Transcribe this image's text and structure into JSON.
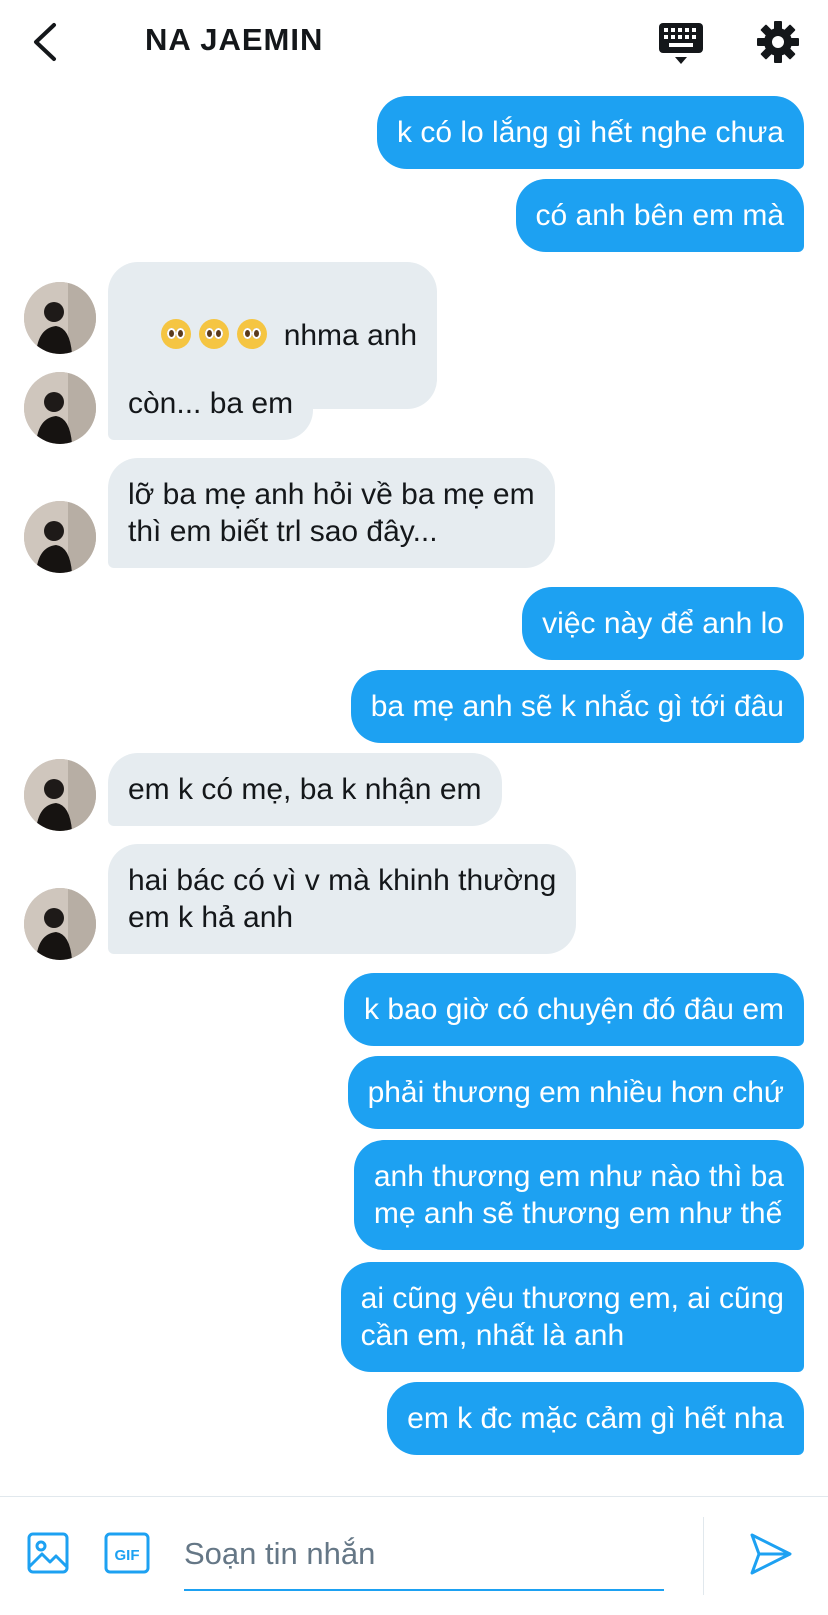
{
  "header": {
    "title": "NA JAEMIN",
    "back_icon": "chevron-left-icon",
    "keyboard_icon": "keyboard-icon",
    "settings_icon": "gear-icon"
  },
  "messages": [
    {
      "side": "sent",
      "text": "k có lo lắng gì hết nghe chưa"
    },
    {
      "side": "sent",
      "text": "có anh bên em mà"
    },
    {
      "side": "received",
      "text": "nhma anh",
      "emoji": [
        "pleading-face",
        "pleading-face",
        "pleading-face"
      ]
    },
    {
      "side": "received",
      "text": "còn... ba em"
    },
    {
      "side": "received",
      "text": "lỡ ba mẹ anh hỏi về ba mẹ em\nthì em biết trl sao đây..."
    },
    {
      "side": "sent",
      "text": "việc này để anh lo"
    },
    {
      "side": "sent",
      "text": "ba mẹ anh sẽ k nhắc gì tới đâu"
    },
    {
      "side": "received",
      "text": "em k có mẹ, ba k nhận em"
    },
    {
      "side": "received",
      "text": "hai bác có vì v mà khinh thường\nem k hả anh"
    },
    {
      "side": "sent",
      "text": "k bao giờ có chuyện đó đâu em"
    },
    {
      "side": "sent",
      "text": "phải thương em nhiều hơn chứ"
    },
    {
      "side": "sent",
      "text": "anh thương em như nào thì ba\nmẹ anh sẽ thương em như thế"
    },
    {
      "side": "sent",
      "text": "ai cũng yêu thương em, ai cũng\ncần em, nhất là anh"
    },
    {
      "side": "sent",
      "text": "em k đc mặc cảm gì hết nha"
    }
  ],
  "composer": {
    "placeholder": "Soạn tin nhắn",
    "value": "",
    "gif_label": "GIF",
    "image_icon": "image-icon",
    "send_icon": "send-icon"
  },
  "colors": {
    "sent_bubble": "#1da1f2",
    "received_bubble": "#e6ecf0",
    "accent": "#1da1f2"
  }
}
